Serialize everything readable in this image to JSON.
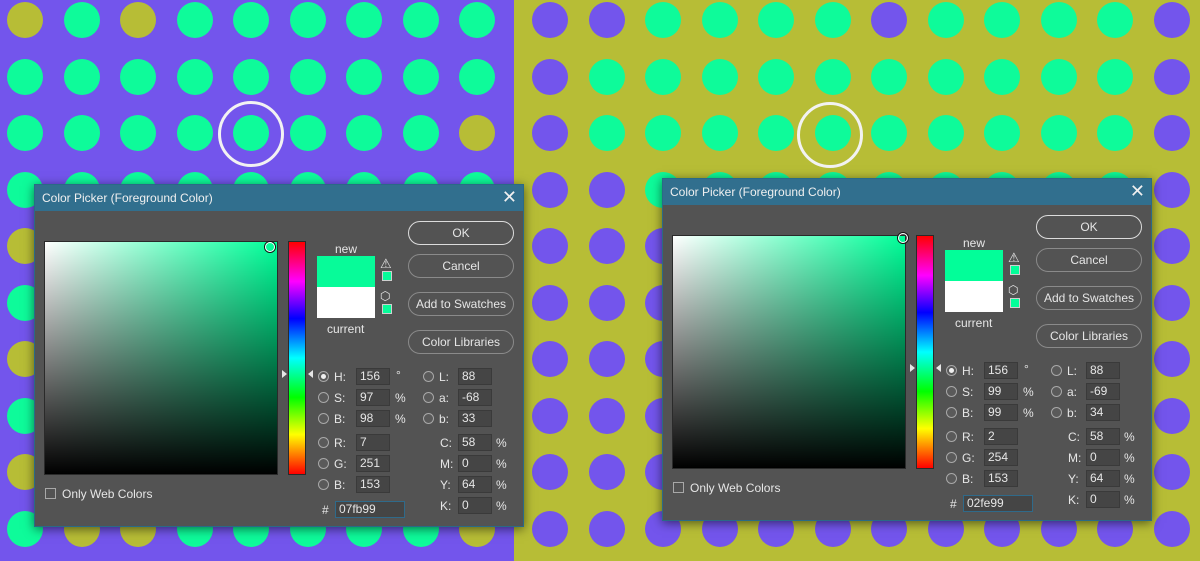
{
  "colors": {
    "left_bg": "#7355ec",
    "right_bg": "#b7bd36",
    "dot_green": "#0efb9a",
    "dot_yellow": "#b7bd36",
    "dot_purple": "#7355ec"
  },
  "dialogs": [
    {
      "title": "Color Picker (Foreground Color)",
      "close_glyph": "✕",
      "new_label": "new",
      "current_label": "current",
      "new_color": "#07fb99",
      "current_color": "#ffffff",
      "buttons": {
        "ok": "OK",
        "cancel": "Cancel",
        "add_swatches": "Add to Swatches",
        "color_libraries": "Color Libraries"
      },
      "labels": {
        "h": "H:",
        "s": "S:",
        "b": "B:",
        "r": "R:",
        "g": "G:",
        "b2": "B:",
        "l": "L:",
        "a": "a:",
        "lab_b": "b:",
        "c": "C:",
        "m": "M:",
        "y": "Y:",
        "k": "K:",
        "hash": "#"
      },
      "units": {
        "deg": "°",
        "pct": "%"
      },
      "values": {
        "h": "156",
        "s": "97",
        "b": "98",
        "r": "7",
        "g": "251",
        "b2": "153",
        "l": "88",
        "a": "-68",
        "lab_b": "33",
        "c": "58",
        "m": "0",
        "y": "64",
        "k": "0",
        "hex": "07fb99"
      },
      "only_web_colors": "Only Web Colors",
      "warn_icon": "⚠",
      "cube_icon": "⬡"
    },
    {
      "title": "Color Picker (Foreground Color)",
      "close_glyph": "✕",
      "new_label": "new",
      "current_label": "current",
      "new_color": "#02fe99",
      "current_color": "#ffffff",
      "buttons": {
        "ok": "OK",
        "cancel": "Cancel",
        "add_swatches": "Add to Swatches",
        "color_libraries": "Color Libraries"
      },
      "labels": {
        "h": "H:",
        "s": "S:",
        "b": "B:",
        "r": "R:",
        "g": "G:",
        "b2": "B:",
        "l": "L:",
        "a": "a:",
        "lab_b": "b:",
        "c": "C:",
        "m": "M:",
        "y": "Y:",
        "k": "K:",
        "hash": "#"
      },
      "units": {
        "deg": "°",
        "pct": "%"
      },
      "values": {
        "h": "156",
        "s": "99",
        "b": "99",
        "r": "2",
        "g": "254",
        "b2": "153",
        "l": "88",
        "a": "-69",
        "lab_b": "34",
        "c": "58",
        "m": "0",
        "y": "64",
        "k": "0",
        "hex": "02fe99"
      },
      "only_web_colors": "Only Web Colors",
      "warn_icon": "⚠",
      "cube_icon": "⬡"
    }
  ]
}
